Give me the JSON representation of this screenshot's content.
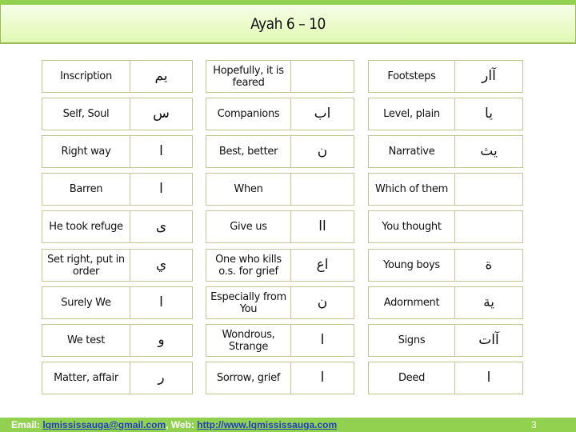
{
  "title": "Ayah 6 – 10",
  "vocabulary": {
    "columns": [
      {
        "rows": [
          {
            "english": "Inscription",
            "arabic": "يم"
          },
          {
            "english": "Self, Soul",
            "arabic": "س"
          },
          {
            "english": "Right way",
            "arabic": "ا"
          },
          {
            "english": "Barren",
            "arabic": "ا"
          },
          {
            "english": "He took refuge",
            "arabic": "ى"
          },
          {
            "english": "Set right, put in order",
            "arabic": "ي"
          },
          {
            "english": "Surely We",
            "arabic": "ا"
          },
          {
            "english": "We test",
            "arabic": "و"
          },
          {
            "english": "Matter, affair",
            "arabic": "ر"
          }
        ]
      },
      {
        "rows": [
          {
            "english": "Hopefully, it is feared",
            "arabic": ""
          },
          {
            "english": "Companions",
            "arabic": "اب"
          },
          {
            "english": "Best, better",
            "arabic": "ن"
          },
          {
            "english": "When",
            "arabic": ""
          },
          {
            "english": "Give us",
            "arabic": "اا"
          },
          {
            "english": "One who kills o.s. for grief",
            "arabic": "اع"
          },
          {
            "english": "Especially from You",
            "arabic": "ن"
          },
          {
            "english": "Wondrous, Strange",
            "arabic": "ا"
          },
          {
            "english": "Sorrow, grief",
            "arabic": "ا"
          }
        ]
      },
      {
        "rows": [
          {
            "english": "Footsteps",
            "arabic": "آار"
          },
          {
            "english": "Level, plain",
            "arabic": "يا"
          },
          {
            "english": "Narrative",
            "arabic": "يث"
          },
          {
            "english": "Which of them",
            "arabic": ""
          },
          {
            "english": "You thought",
            "arabic": ""
          },
          {
            "english": "Young boys",
            "arabic": "ة"
          },
          {
            "english": "Adornment",
            "arabic": "ية"
          },
          {
            "english": "Signs",
            "arabic": "آات"
          },
          {
            "english": "Deed",
            "arabic": "ا"
          }
        ]
      }
    ]
  },
  "footer": {
    "email_label": "Email: ",
    "email": "lqmississauga@gmail.com",
    "separator": ", ",
    "web_label": "Web: ",
    "web": "http://www.lqmississauga.com",
    "page_number": "3"
  },
  "colors": {
    "accent_green": "#92d050",
    "title_border": "#9bbb59",
    "cell_border": "#c3c49a",
    "link": "#1f3fbf"
  }
}
